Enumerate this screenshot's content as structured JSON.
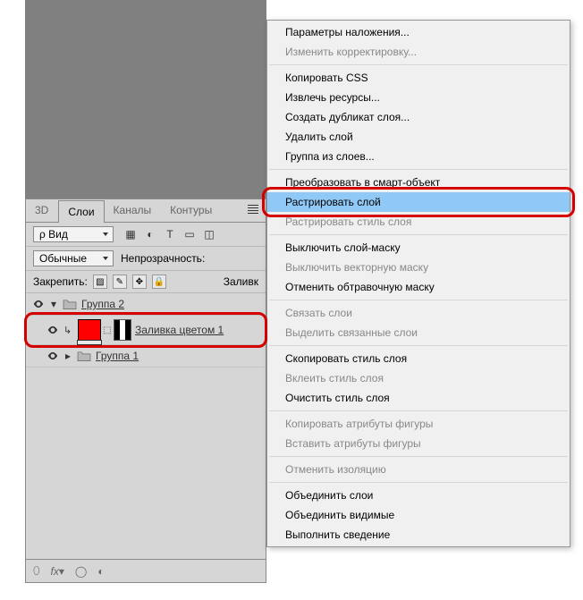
{
  "panel": {
    "tabs": [
      "3D",
      "Слои",
      "Каналы",
      "Контуры"
    ],
    "activeTabIndex": 1,
    "filterLabel": "ρ Вид",
    "blendMode": "Обычные",
    "opacityLabel": "Непрозрачность:",
    "lockLabel": "Закрепить:",
    "fillLabel": "Заливк"
  },
  "layers": {
    "group2": "Группа 2",
    "fillLayer": "Заливка цветом 1",
    "group1": "Группа 1"
  },
  "contextMenu": {
    "items": [
      {
        "label": "Параметры наложения...",
        "disabled": false
      },
      {
        "label": "Изменить корректировку...",
        "disabled": true
      },
      {
        "sep": true
      },
      {
        "label": "Копировать CSS",
        "disabled": false
      },
      {
        "label": "Извлечь ресурсы...",
        "disabled": false
      },
      {
        "label": "Создать дубликат слоя...",
        "disabled": false
      },
      {
        "label": "Удалить слой",
        "disabled": false
      },
      {
        "label": "Группа из слоев...",
        "disabled": false
      },
      {
        "sep": true
      },
      {
        "label": "Преобразовать в смарт-объект",
        "disabled": false
      },
      {
        "label": "Растрировать слой",
        "disabled": false,
        "highlighted": true
      },
      {
        "label": "Растрировать стиль слоя",
        "disabled": true
      },
      {
        "sep": true
      },
      {
        "label": "Выключить слой-маску",
        "disabled": false
      },
      {
        "label": "Выключить векторную маску",
        "disabled": true
      },
      {
        "label": "Отменить обтравочную маску",
        "disabled": false
      },
      {
        "sep": true
      },
      {
        "label": "Связать слои",
        "disabled": true
      },
      {
        "label": "Выделить связанные слои",
        "disabled": true
      },
      {
        "sep": true
      },
      {
        "label": "Скопировать стиль слоя",
        "disabled": false
      },
      {
        "label": "Вклеить стиль слоя",
        "disabled": true
      },
      {
        "label": "Очистить стиль слоя",
        "disabled": false
      },
      {
        "sep": true
      },
      {
        "label": "Копировать атрибуты фигуры",
        "disabled": true
      },
      {
        "label": "Вставить атрибуты фигуры",
        "disabled": true
      },
      {
        "sep": true
      },
      {
        "label": "Отменить изоляцию",
        "disabled": true
      },
      {
        "sep": true
      },
      {
        "label": "Объединить слои",
        "disabled": false
      },
      {
        "label": "Объединить видимые",
        "disabled": false
      },
      {
        "label": "Выполнить сведение",
        "disabled": false
      }
    ]
  },
  "colors": {
    "highlight": "#d40000",
    "fill": "#ff0000"
  }
}
